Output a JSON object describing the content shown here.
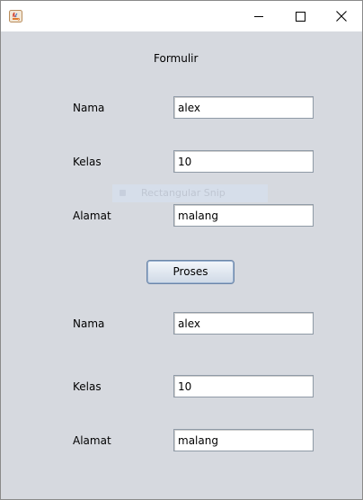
{
  "window": {
    "title": "",
    "icon": "java-cup-icon",
    "controls": {
      "minimize": "minimize-icon",
      "maximize": "maximize-icon",
      "close": "close-icon"
    }
  },
  "form": {
    "heading": "Formulir",
    "input_section": {
      "nama_label": "Nama",
      "nama_value": "alex",
      "kelas_label": "Kelas",
      "kelas_value": "10",
      "alamat_label": "Alamat",
      "alamat_value": "malang"
    },
    "button_label": "Proses",
    "output_section": {
      "nama_label": "Nama",
      "nama_value": "alex",
      "kelas_label": "Kelas",
      "kelas_value": "10",
      "alamat_label": "Alamat",
      "alamat_value": "malang"
    }
  },
  "overlay": {
    "snip_label": "Rectangular Snip"
  }
}
